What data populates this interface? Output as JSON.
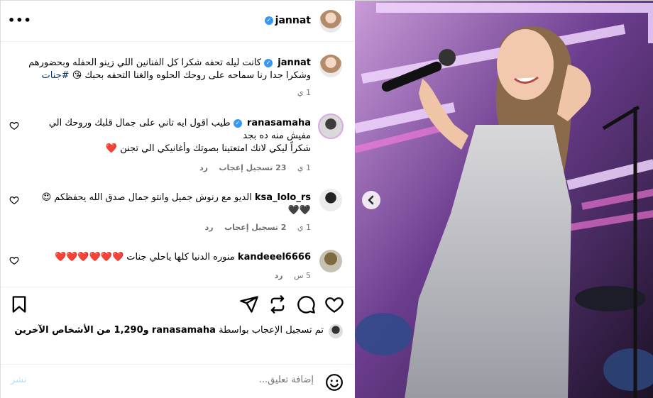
{
  "post": {
    "author": "jannat",
    "more_label": "•••",
    "caption": {
      "username": "jannat",
      "text": "كانت ليله تحفه شكرا كل الفنانين اللي زينو الحفله وبحضورهم وشكرا جدا رنا سماحه على روحك الحلوه والغنا التحفه بحبك 😘",
      "hashtag": "#جنات",
      "time": "1 ي"
    },
    "comments": [
      {
        "username": "ranasamaha",
        "verified": true,
        "line1": "طيب اقول ايه تاني على جمال قلبك وروحك الي",
        "line2": "مفيش منه ده بجد",
        "line3": "شكراً ليكي لانك امتعتينا بصوتك وأغانيكي الي تجنن ❤️",
        "time": "1 ي",
        "likes": "23 تسجيل إعجاب",
        "reply": "رد"
      },
      {
        "username": "ksa_lolo_rs",
        "verified": false,
        "line1": "الديو مع رنوش جميل وانتو جمال صدق الله يحفظكم 😍",
        "line2": "🖤🖤",
        "time": "1 ي",
        "likes": "2 تسجيل إعجاب",
        "reply": "رد"
      },
      {
        "username": "kandeeel6666",
        "verified": false,
        "line1": "منوره الدنيا كلها ياحلي جنات ❤️❤️❤️❤️❤️❤️",
        "time": "5 س",
        "reply": "رد"
      }
    ],
    "likes_summary": {
      "prefix": "تم تسجيل الإعجاب بواسطة",
      "user": "ranasamaha",
      "suffix": "و1,290 من الأشخاص الآخرين"
    },
    "add_comment": {
      "placeholder": "إضافة تعليق...",
      "post_label": "نشر"
    }
  },
  "icons": {
    "like": "heart-icon",
    "comment": "comment-icon",
    "share": "share-icon",
    "repost": "repost-icon",
    "save": "bookmark-icon",
    "emoji": "emoji-icon",
    "prev": "chevron-left-icon"
  },
  "colors": {
    "verified": "#3897f0",
    "hashtag": "#00376b",
    "heart": "#ed4956",
    "post_button": "#b2dffc"
  }
}
